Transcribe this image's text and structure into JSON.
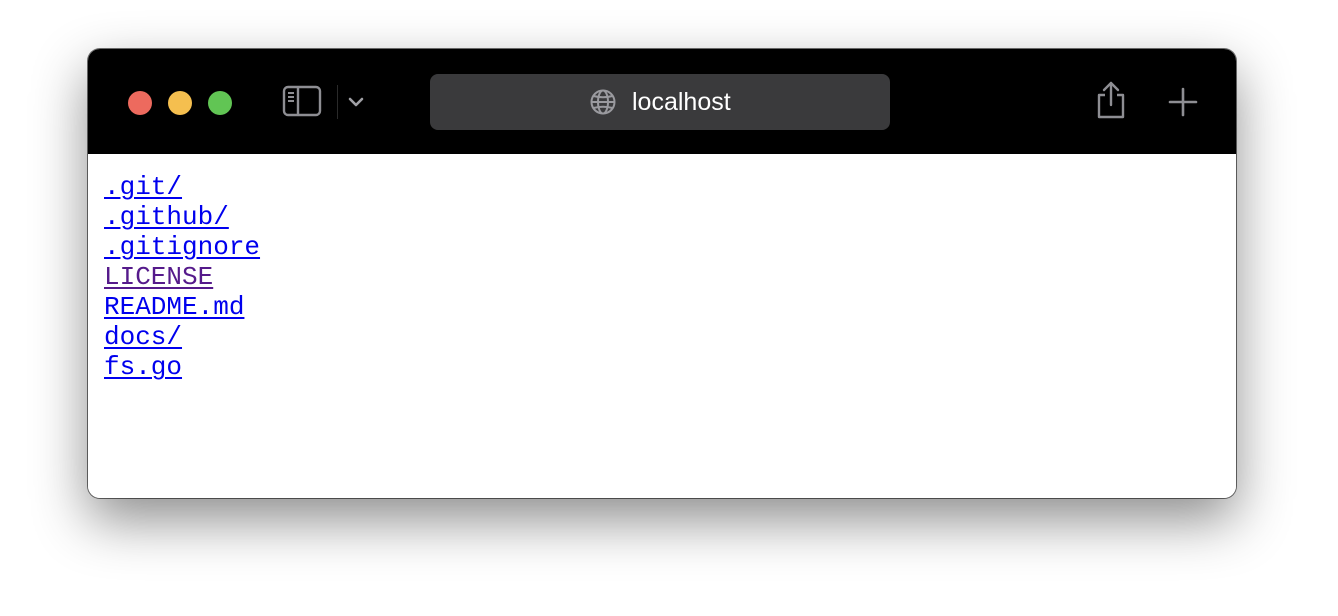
{
  "window": {
    "controls": {
      "close_color": "#ED6A5E",
      "minimize_color": "#F5BF4F",
      "zoom_color": "#61C554"
    }
  },
  "toolbar": {
    "sidebar_icon": "sidebar-icon",
    "tab_overview_icon": "chevron-down-icon",
    "address": "localhost",
    "address_icon": "globe-icon",
    "share_icon": "share-icon",
    "new_tab_icon": "plus-icon"
  },
  "colors": {
    "toolbar_bg": "#000000",
    "address_bar_bg": "#3A3A3C",
    "link": "#0000EE",
    "visited_link": "#551A8B"
  },
  "listing": {
    "entries": [
      {
        "name": ".git/",
        "visited": false
      },
      {
        "name": ".github/",
        "visited": false
      },
      {
        "name": ".gitignore",
        "visited": false
      },
      {
        "name": "LICENSE",
        "visited": true
      },
      {
        "name": "README.md",
        "visited": false
      },
      {
        "name": "docs/",
        "visited": false
      },
      {
        "name": "fs.go",
        "visited": false
      }
    ]
  }
}
